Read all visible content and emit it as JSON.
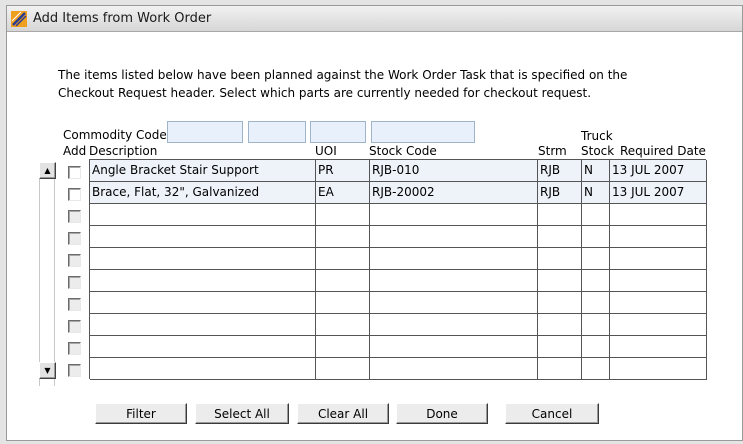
{
  "window": {
    "title": "Add Items from Work Order"
  },
  "intro": {
    "line1": "The items listed below have been planned against the Work Order Task that is specified on the",
    "line2": "Checkout Request header.  Select which parts are currently needed for checkout request."
  },
  "commodity_code": {
    "label": "Commodity Code",
    "segments": [
      "",
      "",
      "",
      ""
    ]
  },
  "columns": {
    "add": "Add",
    "description": "Description",
    "uoi": "UOI",
    "stock_code": "Stock Code",
    "strm": "Strm",
    "truck": "Truck",
    "stock": "Stock",
    "required_date": "Required Date"
  },
  "rows": [
    {
      "checked": false,
      "description": "Angle Bracket Stair Support",
      "uoi": "PR",
      "stock_code": "RJB-010",
      "strm": "RJB",
      "truck_stock": "N",
      "required_date": "13 JUL 2007"
    },
    {
      "checked": false,
      "description": "Brace, Flat, 32\", Galvanized",
      "uoi": "EA",
      "stock_code": "RJB-20002",
      "strm": "RJB",
      "truck_stock": "N",
      "required_date": "13 JUL 2007"
    },
    {
      "checked": false,
      "description": "",
      "uoi": "",
      "stock_code": "",
      "strm": "",
      "truck_stock": "",
      "required_date": ""
    },
    {
      "checked": false,
      "description": "",
      "uoi": "",
      "stock_code": "",
      "strm": "",
      "truck_stock": "",
      "required_date": ""
    },
    {
      "checked": false,
      "description": "",
      "uoi": "",
      "stock_code": "",
      "strm": "",
      "truck_stock": "",
      "required_date": ""
    },
    {
      "checked": false,
      "description": "",
      "uoi": "",
      "stock_code": "",
      "strm": "",
      "truck_stock": "",
      "required_date": ""
    },
    {
      "checked": false,
      "description": "",
      "uoi": "",
      "stock_code": "",
      "strm": "",
      "truck_stock": "",
      "required_date": ""
    },
    {
      "checked": false,
      "description": "",
      "uoi": "",
      "stock_code": "",
      "strm": "",
      "truck_stock": "",
      "required_date": ""
    },
    {
      "checked": false,
      "description": "",
      "uoi": "",
      "stock_code": "",
      "strm": "",
      "truck_stock": "",
      "required_date": ""
    },
    {
      "checked": false,
      "description": "",
      "uoi": "",
      "stock_code": "",
      "strm": "",
      "truck_stock": "",
      "required_date": ""
    }
  ],
  "buttons": {
    "filter": "Filter",
    "select_all": "Select All",
    "clear_all": "Clear All",
    "done": "Done",
    "cancel": "Cancel"
  },
  "icons": {
    "window": "app-logo-icon",
    "scroll_up": "scroll-up-arrow-icon",
    "scroll_down": "scroll-down-arrow-icon"
  }
}
